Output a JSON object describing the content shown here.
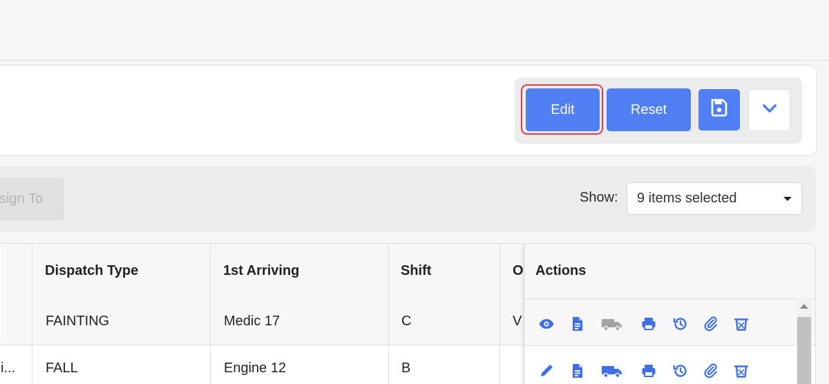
{
  "toolbar": {
    "edit_label": "Edit",
    "reset_label": "Reset",
    "save_icon": "floppy-disk-icon",
    "dropdown_icon": "chevron-down-icon"
  },
  "filter_bar": {
    "assign_label": "Assign To",
    "show_label": "Show:",
    "show_value": "9 items selected"
  },
  "table": {
    "headers": {
      "dispatch_type": "Dispatch Type",
      "first_arriving": "1st Arriving",
      "shift": "Shift",
      "partial": "O",
      "actions": "Actions"
    },
    "rows": [
      {
        "prev": "",
        "dispatch_type": "FAINTING",
        "first_arriving": "Medic 17",
        "shift": "C",
        "partial": "V"
      },
      {
        "prev": "i...",
        "dispatch_type": "FALL",
        "first_arriving": "Engine 12",
        "shift": "B",
        "partial": ""
      }
    ],
    "action_icons": [
      [
        "eye-icon",
        "document-icon",
        "truck-icon",
        "printer-icon",
        "history-icon",
        "paperclip-icon",
        "trash-icon"
      ],
      [
        "pencil-icon",
        "document-icon",
        "truck-icon",
        "printer-icon",
        "history-icon",
        "paperclip-icon",
        "trash-icon"
      ]
    ]
  },
  "colors": {
    "primary": "#4f7ff3",
    "icon_blue": "#3f6fe4",
    "icon_gray": "#a3a3a3",
    "highlight": "#e0394f"
  }
}
